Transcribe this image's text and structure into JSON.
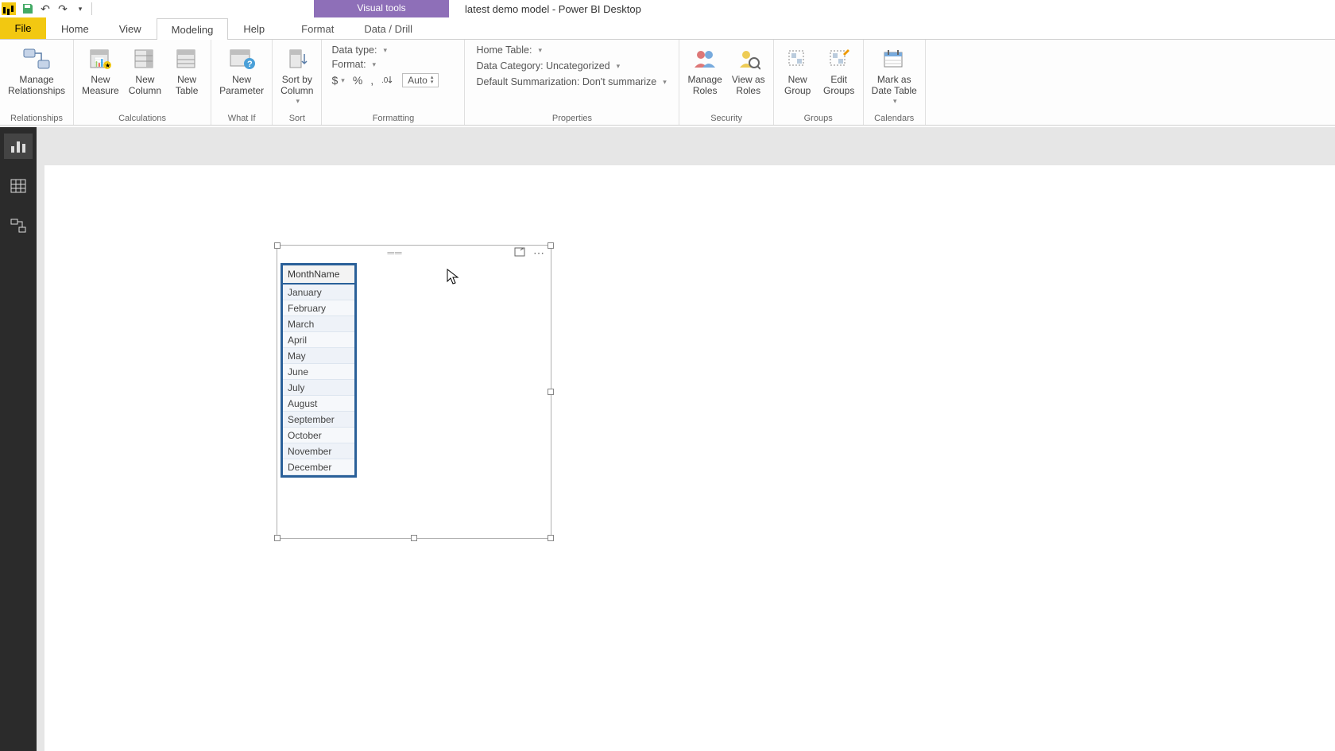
{
  "window": {
    "title": "latest demo model - Power BI Desktop",
    "contextual_group": "Visual tools"
  },
  "qat": {
    "save": "💾",
    "undo": "↶",
    "redo": "↷"
  },
  "tabs": {
    "file": "File",
    "home": "Home",
    "view": "View",
    "modeling": "Modeling",
    "help": "Help",
    "format": "Format",
    "data_drill": "Data / Drill"
  },
  "ribbon": {
    "relationships": {
      "label": "Relationships",
      "manage": "Manage\nRelationships"
    },
    "calculations": {
      "label": "Calculations",
      "new_measure": "New\nMeasure",
      "new_column": "New\nColumn",
      "new_table": "New\nTable"
    },
    "whatif": {
      "label": "What If",
      "new_parameter": "New\nParameter"
    },
    "sort": {
      "label": "Sort",
      "sort_by_column": "Sort by\nColumn"
    },
    "formatting": {
      "label": "Formatting",
      "data_type": "Data type:",
      "format": "Format:",
      "auto": "Auto",
      "currency": "$",
      "percent": "%",
      "comma": ",",
      "decimals": ".0"
    },
    "properties": {
      "label": "Properties",
      "home_table": "Home Table:",
      "data_category": "Data Category: Uncategorized",
      "default_summarization": "Default Summarization: Don't summarize"
    },
    "security": {
      "label": "Security",
      "manage_roles": "Manage\nRoles",
      "view_as_roles": "View as\nRoles"
    },
    "groups": {
      "label": "Groups",
      "new_group": "New\nGroup",
      "edit_groups": "Edit\nGroups"
    },
    "calendars": {
      "label": "Calendars",
      "mark_as_date": "Mark as\nDate Table"
    }
  },
  "visual": {
    "column_header": "MonthName",
    "rows": [
      "January",
      "February",
      "March",
      "April",
      "May",
      "June",
      "July",
      "August",
      "September",
      "October",
      "November",
      "December"
    ]
  }
}
